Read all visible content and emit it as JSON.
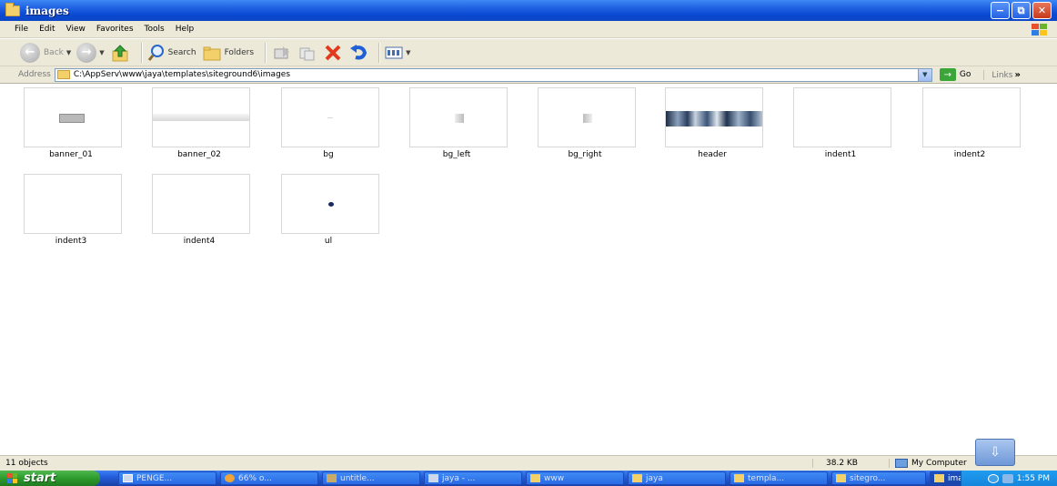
{
  "window": {
    "title": "images"
  },
  "menu": [
    "File",
    "Edit",
    "View",
    "Favorites",
    "Tools",
    "Help"
  ],
  "toolbar": {
    "back_label": "Back",
    "search_label": "Search",
    "folders_label": "Folders"
  },
  "address": {
    "label": "Address",
    "path": "C:\\AppServ\\www\\jaya\\templates\\siteground6\\images",
    "go_label": "Go",
    "links_label": "Links"
  },
  "files": [
    {
      "name": "banner_01"
    },
    {
      "name": "banner_02"
    },
    {
      "name": "bg"
    },
    {
      "name": "bg_left"
    },
    {
      "name": "bg_right"
    },
    {
      "name": "header"
    },
    {
      "name": "indent1"
    },
    {
      "name": "indent2"
    },
    {
      "name": "indent3"
    },
    {
      "name": "indent4"
    },
    {
      "name": "ul"
    }
  ],
  "status": {
    "objects": "11 objects",
    "size": "38.2 KB",
    "zone": "My Computer"
  },
  "taskbar": {
    "start_label": "start",
    "tasks": [
      "PENGE...",
      "66% o...",
      "untitle...",
      "jaya - ...",
      "www",
      "jaya",
      "templa...",
      "sitegro...",
      "images"
    ],
    "active_task": "images",
    "clock": "1:55 PM"
  }
}
